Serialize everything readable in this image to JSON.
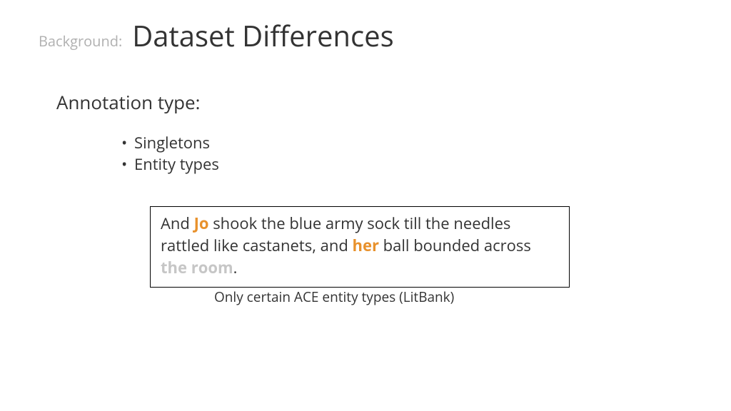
{
  "header": {
    "kicker": "Background:",
    "title": "Dataset Differences"
  },
  "section": {
    "subhead": "Annotation type:",
    "bullets": [
      "Singletons",
      "Entity types"
    ]
  },
  "example": {
    "t1": "And ",
    "h1": "Jo",
    "t2": " shook the blue army sock till the needles rattled like castanets, and ",
    "h2": "her",
    "t3": " ball bounded across ",
    "h3": "the room",
    "t4": "."
  },
  "caption": "Only certain ACE entity types (LitBank)"
}
